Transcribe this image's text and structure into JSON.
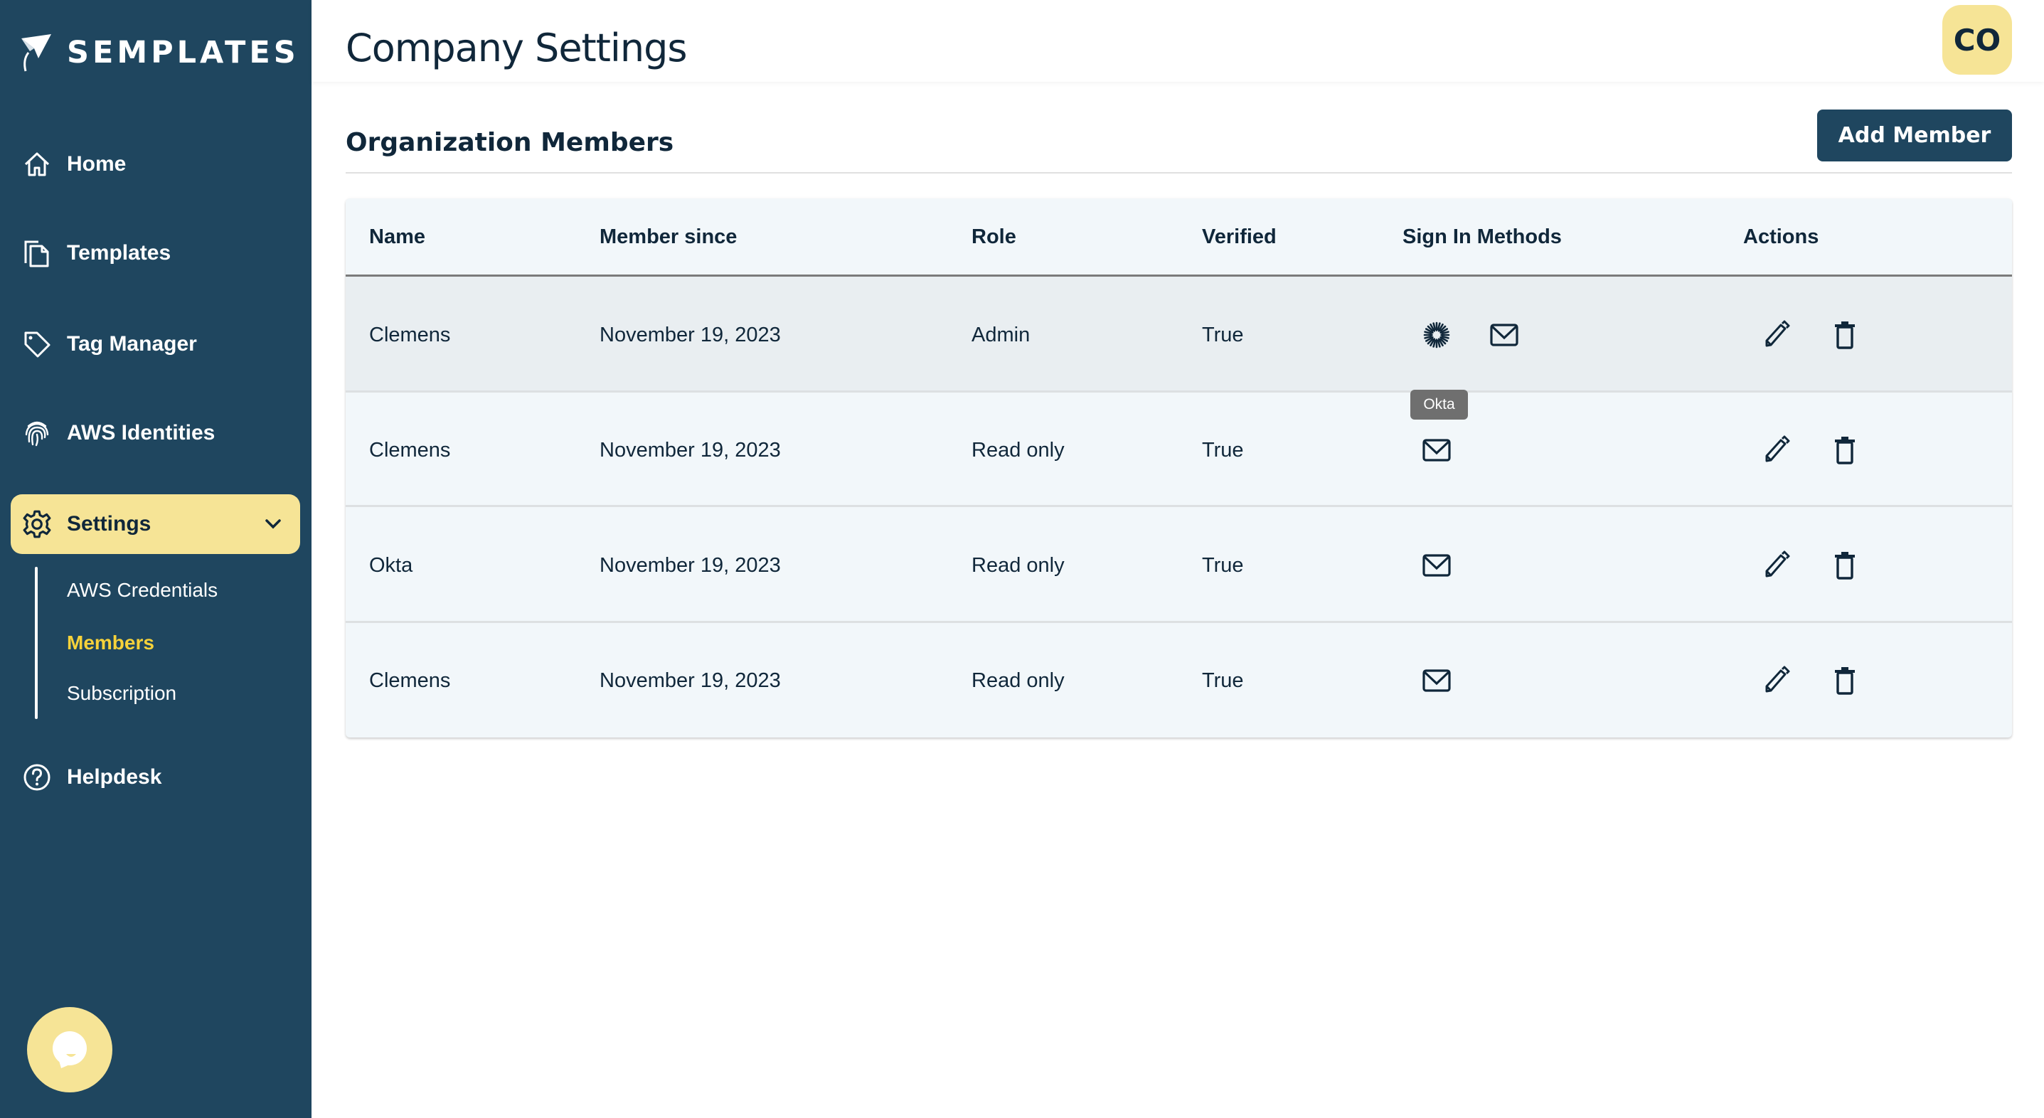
{
  "app": {
    "brand": "SEMPLATES",
    "page_title": "Company Settings",
    "avatar_initials": "CO"
  },
  "sidebar": {
    "items": [
      {
        "label": "Home",
        "icon": "home-icon"
      },
      {
        "label": "Templates",
        "icon": "copy-icon"
      },
      {
        "label": "Tag Manager",
        "icon": "tag-icon"
      },
      {
        "label": "AWS Identities",
        "icon": "fingerprint-icon"
      },
      {
        "label": "Settings",
        "icon": "gear-icon",
        "expanded": true
      },
      {
        "label": "Helpdesk",
        "icon": "help-circle-icon"
      }
    ],
    "settings_subitems": [
      {
        "label": "AWS Credentials",
        "active": false
      },
      {
        "label": "Members",
        "active": true
      },
      {
        "label": "Subscription",
        "active": false
      }
    ]
  },
  "section": {
    "title": "Organization Members",
    "add_button": "Add Member"
  },
  "table": {
    "columns": [
      "Name",
      "Member since",
      "Role",
      "Verified",
      "Sign In Methods",
      "Actions"
    ],
    "rows": [
      {
        "name": "Clemens",
        "member_since": "November 19, 2023",
        "role": "Admin",
        "verified": "True",
        "sign_in_methods": [
          "okta",
          "email"
        ]
      },
      {
        "name": "Clemens",
        "member_since": "November 19, 2023",
        "role": "Read only",
        "verified": "True",
        "sign_in_methods": [
          "email"
        ]
      },
      {
        "name": "Okta",
        "member_since": "November 19, 2023",
        "role": "Read only",
        "verified": "True",
        "sign_in_methods": [
          "email"
        ]
      },
      {
        "name": "Clemens",
        "member_since": "November 19, 2023",
        "role": "Read only",
        "verified": "True",
        "sign_in_methods": [
          "email"
        ]
      }
    ],
    "tooltip": "Okta"
  },
  "colors": {
    "sidebar_bg": "#1f465f",
    "accent_yellow": "#f6e496",
    "active_link": "#f6d23a",
    "text_dark": "#10273a",
    "table_bg": "#f2f7fa",
    "row_hover": "#e9eef1"
  }
}
